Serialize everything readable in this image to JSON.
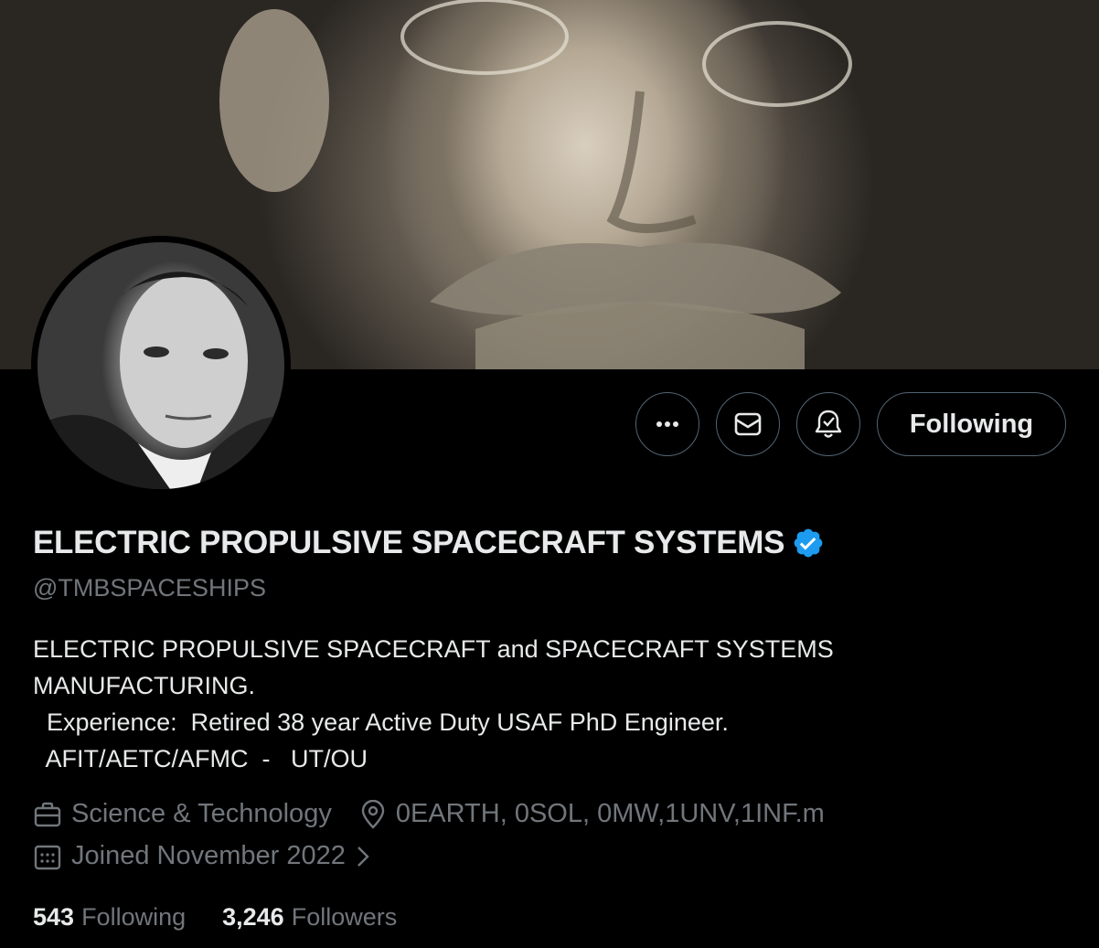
{
  "profile": {
    "name": "ELECTRIC PROPULSIVE SPACECRAFT SYSTEMS",
    "handle": "@TMBSPACESHIPS",
    "bio_lines": [
      "ELECTRIC PROPULSIVE SPACECRAFT and SPACECRAFT SYSTEMS",
      "MANUFACTURING.",
      "  Experience:  Retired 38 year Active Duty USAF PhD Engineer.",
      "  AFIT/AETC/AFMC  -   UT/OU"
    ],
    "category": "Science & Technology",
    "location": "0EARTH, 0SOL, 0MW,1UNV,1INF.m",
    "joined": "Joined November 2022",
    "following_count": "543",
    "following_label": "Following",
    "followers_count": "3,246",
    "followers_label": "Followers"
  },
  "actions": {
    "more_label": "•••",
    "follow_label": "Following"
  },
  "icons": {
    "more": "more-icon",
    "message": "envelope-icon",
    "notify": "bell-check-icon",
    "verified": "verified-badge-icon",
    "category": "briefcase-icon",
    "location": "location-pin-icon",
    "joined": "calendar-icon",
    "joined_more": "chevron-right-icon"
  },
  "colors": {
    "background": "#000000",
    "text": "#e7e9ea",
    "muted": "#71767b",
    "border": "#536471",
    "verified": "#1d9bf0"
  }
}
